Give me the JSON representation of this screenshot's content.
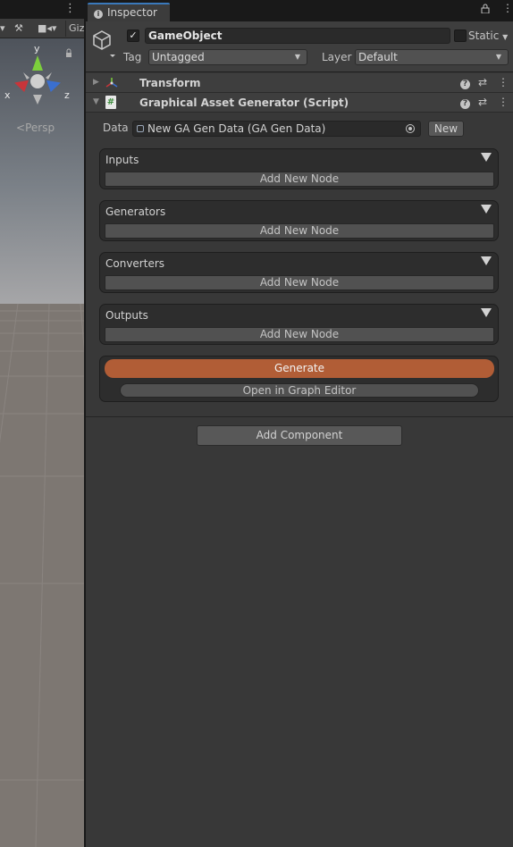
{
  "scene": {
    "toolbar_text": "Giz",
    "gizmo": {
      "y": "y",
      "x": "x",
      "z": "z"
    },
    "persp_label": "Persp"
  },
  "inspector": {
    "tab_title": "Inspector",
    "game_object": {
      "active": true,
      "name": "GameObject",
      "static_label": "Static",
      "tag_label": "Tag",
      "tag_value": "Untagged",
      "layer_label": "Layer",
      "layer_value": "Default"
    },
    "components": [
      {
        "title": "Transform",
        "expanded": false
      },
      {
        "title": "Graphical Asset Generator (Script)",
        "expanded": true
      }
    ],
    "script": {
      "data_label": "Data",
      "data_value": "New GA Gen Data (GA Gen Data)",
      "new_button": "New",
      "node_sections": [
        {
          "title": "Inputs",
          "button": "Add New Node"
        },
        {
          "title": "Generators",
          "button": "Add New Node"
        },
        {
          "title": "Converters",
          "button": "Add New Node"
        },
        {
          "title": "Outputs",
          "button": "Add New Node"
        }
      ],
      "generate_button": "Generate",
      "graph_editor_button": "Open in Graph Editor",
      "accent_color": "#b15d36"
    },
    "add_component_button": "Add Component"
  }
}
